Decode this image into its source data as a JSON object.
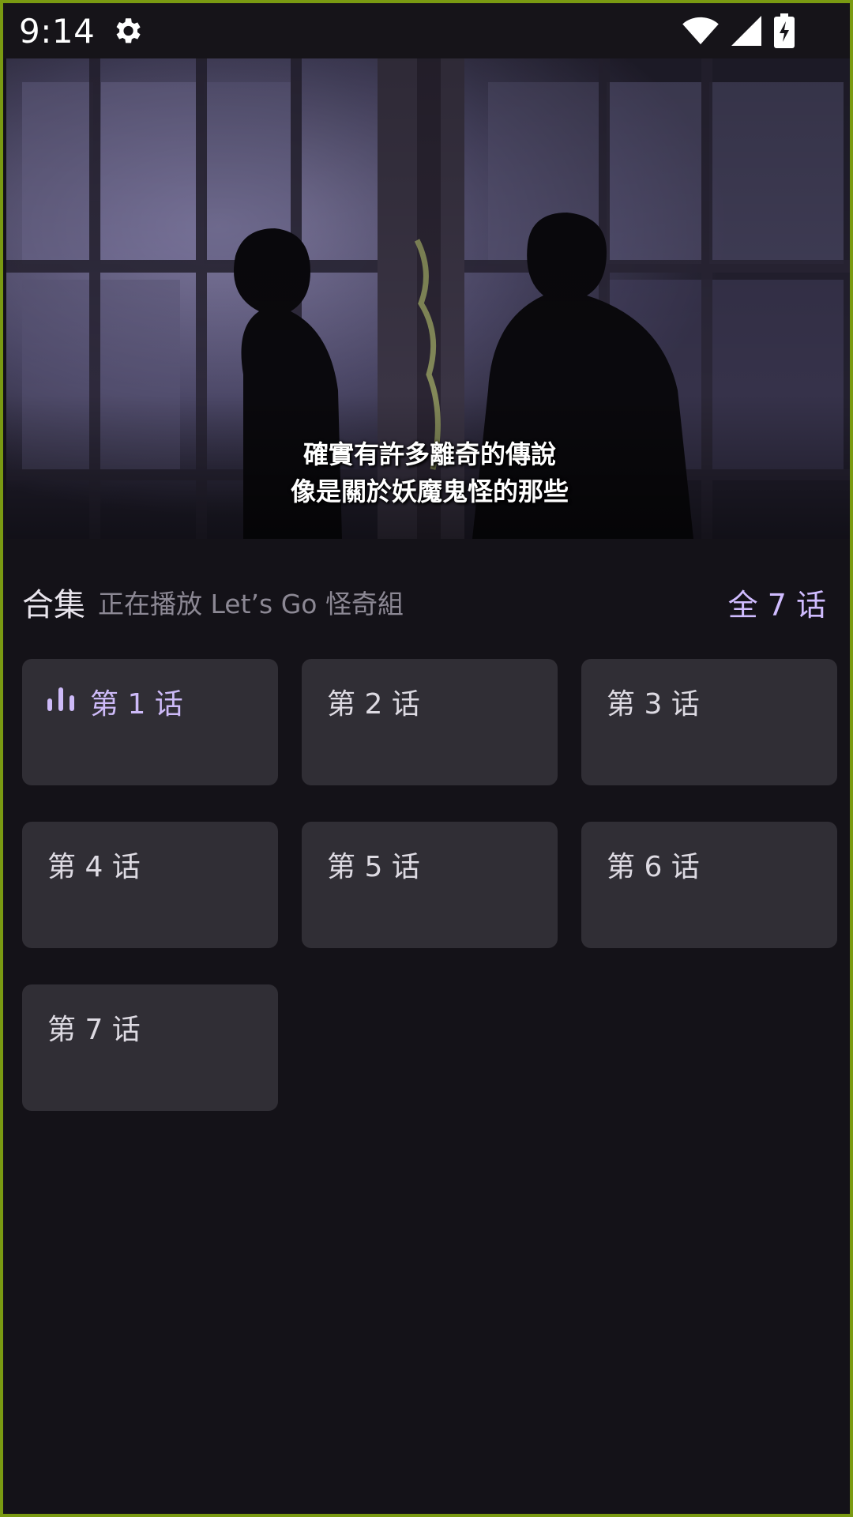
{
  "status_bar": {
    "time": "9:14",
    "icons": [
      "gear-icon",
      "wifi-icon",
      "cellular-signal-icon",
      "battery-charging-icon"
    ]
  },
  "video": {
    "subtitle_line1": "確實有許多離奇的傳說",
    "subtitle_line2": "像是關於妖魔鬼怪的那些"
  },
  "episodes_section": {
    "title": "合集",
    "now_playing": "正在播放 Let’s Go 怪奇組",
    "all_label": "全 7 话"
  },
  "episodes": [
    {
      "label": "第 1 话",
      "active": true
    },
    {
      "label": "第 2 话",
      "active": false
    },
    {
      "label": "第 3 话",
      "active": false
    },
    {
      "label": "第 4 话",
      "active": false
    },
    {
      "label": "第 5 话",
      "active": false
    },
    {
      "label": "第 6 话",
      "active": false
    },
    {
      "label": "第 7 话",
      "active": false
    }
  ],
  "colors": {
    "background": "#141218",
    "card": "#302e35",
    "accent": "#d0bcff",
    "text": "#dddae2"
  }
}
